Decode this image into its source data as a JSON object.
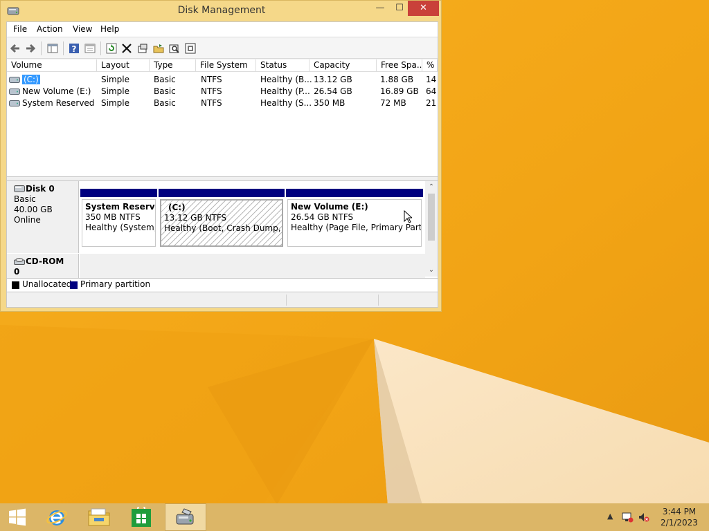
{
  "window": {
    "title": "Disk Management",
    "controls": {
      "minimize": "—",
      "maximize": "☐",
      "close": "✕"
    }
  },
  "menu": [
    "File",
    "Action",
    "View",
    "Help"
  ],
  "toolbar_icons": [
    "back-icon",
    "forward-icon",
    "console-tree-icon",
    "help-icon",
    "properties-icon",
    "refresh-icon",
    "delete-icon",
    "settings-icon",
    "open-folder-icon",
    "search-icon",
    "rescan-icon"
  ],
  "volume_list": {
    "columns": [
      "Volume",
      "Layout",
      "Type",
      "File System",
      "Status",
      "Capacity",
      "Free Spa...",
      "% F"
    ],
    "rows": [
      {
        "volume": "(C:)",
        "layout": "Simple",
        "type": "Basic",
        "fs": "NTFS",
        "status": "Healthy (B...",
        "capacity": "13.12 GB",
        "free": "1.88 GB",
        "pct": "14",
        "selected": true
      },
      {
        "volume": "New Volume (E:)",
        "layout": "Simple",
        "type": "Basic",
        "fs": "NTFS",
        "status": "Healthy (P...",
        "capacity": "26.54 GB",
        "free": "16.89 GB",
        "pct": "64"
      },
      {
        "volume": "System Reserved",
        "layout": "Simple",
        "type": "Basic",
        "fs": "NTFS",
        "status": "Healthy (S...",
        "capacity": "350 MB",
        "free": "72 MB",
        "pct": "21"
      }
    ]
  },
  "disks": [
    {
      "name": "Disk 0",
      "type": "Basic",
      "size": "40.00 GB",
      "state": "Online",
      "partitions": [
        {
          "name": "System Reserved",
          "size": "350 MB NTFS",
          "status": "Healthy (System, Active, Primary Partition)"
        },
        {
          "name": "(C:)",
          "size": "13.12 GB NTFS",
          "status": "Healthy (Boot, Crash Dump, Primary Partition)"
        },
        {
          "name": "New Volume  (E:)",
          "size": "26.54 GB NTFS",
          "status": "Healthy (Page File, Primary Partition)"
        }
      ]
    },
    {
      "name": "CD-ROM 0",
      "type": "CD-ROM (D:)"
    }
  ],
  "legend": [
    {
      "label": "Unallocated",
      "color": "#000000"
    },
    {
      "label": "Primary partition",
      "color": "#00007f"
    }
  ],
  "taskbar": {
    "apps": [
      "start-icon",
      "internet-explorer-icon",
      "file-explorer-icon",
      "store-icon",
      "disk-management-icon"
    ],
    "time": "3:44 PM",
    "date": "2/1/2023"
  }
}
